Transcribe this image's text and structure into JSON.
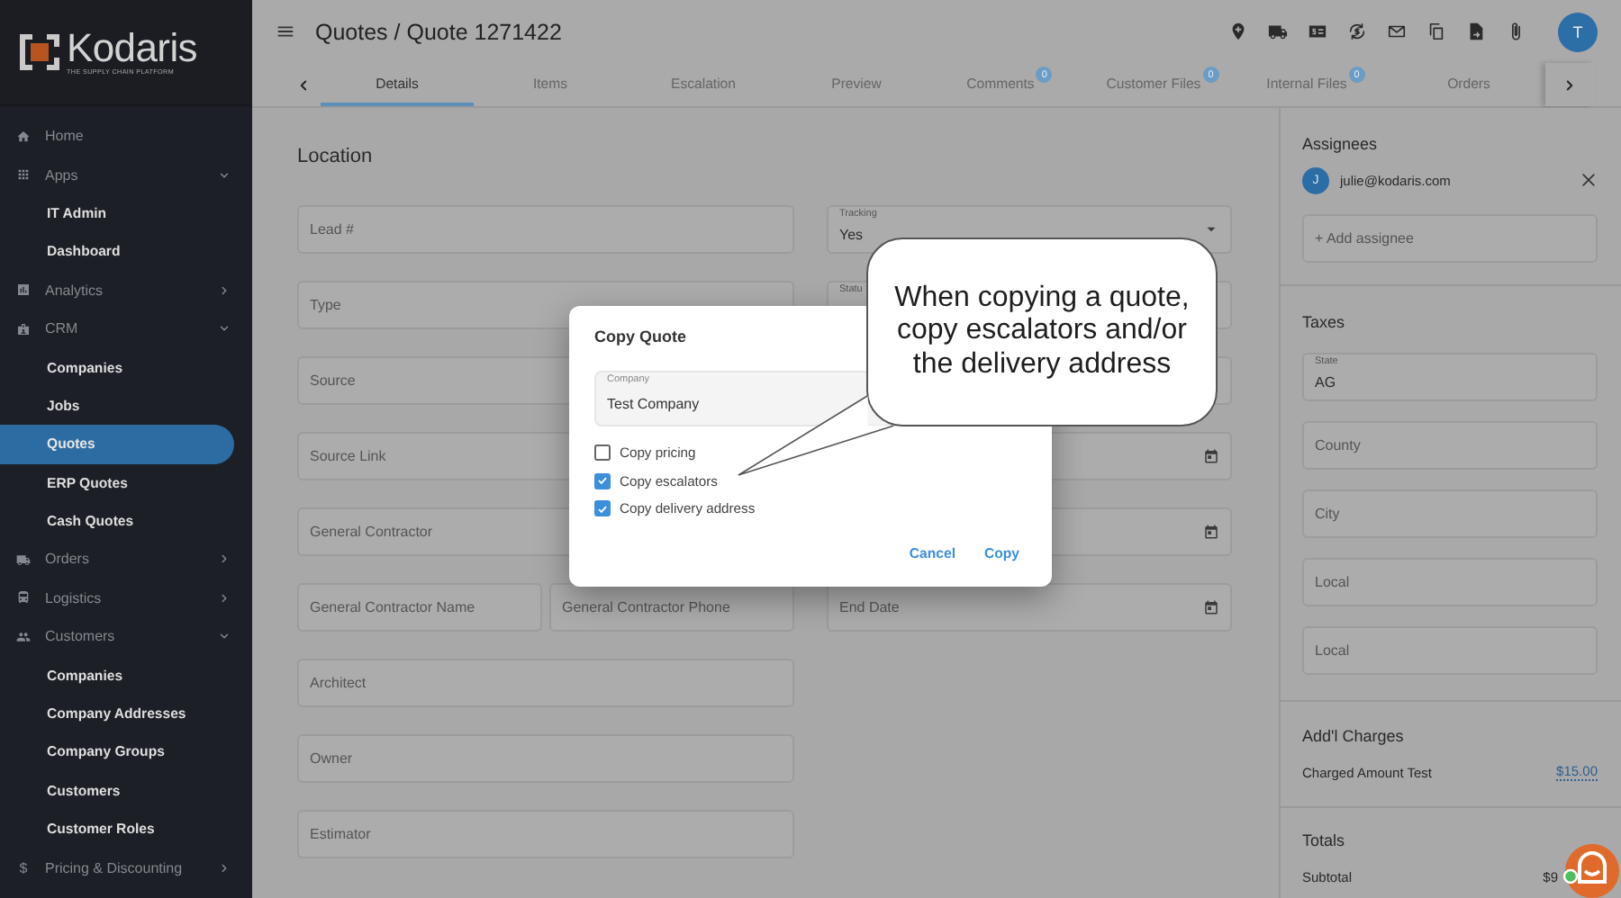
{
  "sidebar": {
    "logo": {
      "name": "Kodaris",
      "tagline": "THE SUPPLY CHAIN PLATFORM"
    },
    "items": [
      {
        "label": "Home"
      },
      {
        "label": "Apps",
        "expanded": true,
        "children": [
          {
            "label": "IT Admin",
            "selected": false
          },
          {
            "label": "Dashboard",
            "selected": false
          }
        ]
      },
      {
        "label": "Analytics",
        "expanded": false
      },
      {
        "label": "CRM",
        "expanded": true,
        "children": [
          {
            "label": "Companies",
            "selected": false
          },
          {
            "label": "Jobs",
            "selected": false
          },
          {
            "label": "Quotes",
            "selected": true
          },
          {
            "label": "ERP Quotes",
            "selected": false
          },
          {
            "label": "Cash Quotes",
            "selected": false
          }
        ]
      },
      {
        "label": "Orders",
        "expanded": false
      },
      {
        "label": "Logistics",
        "expanded": false
      },
      {
        "label": "Customers",
        "expanded": true,
        "children": [
          {
            "label": "Companies",
            "selected": false
          },
          {
            "label": "Company Addresses",
            "selected": false
          },
          {
            "label": "Company Groups",
            "selected": false
          },
          {
            "label": "Customers",
            "selected": false
          },
          {
            "label": "Customer Roles",
            "selected": false
          }
        ]
      },
      {
        "label": "Pricing & Discounting",
        "expanded": false,
        "glyph": "$"
      }
    ]
  },
  "header": {
    "title": "Quotes / Quote 1271422",
    "avatar": "T"
  },
  "tabs": [
    {
      "label": "Details",
      "selected": true
    },
    {
      "label": "Items",
      "selected": false
    },
    {
      "label": "Escalation",
      "selected": false
    },
    {
      "label": "Preview",
      "selected": false
    },
    {
      "label": "Comments",
      "selected": false,
      "badge": "0"
    },
    {
      "label": "Customer Files",
      "selected": false,
      "badge": "0"
    },
    {
      "label": "Internal Files",
      "selected": false,
      "badge": "0"
    },
    {
      "label": "Orders",
      "selected": false
    }
  ],
  "form": {
    "heading": "Location",
    "rows": [
      {
        "left": [
          {
            "placeholder": "Lead #"
          }
        ],
        "right": {
          "kind": "select",
          "label": "Tracking",
          "value": "Yes"
        }
      },
      {
        "left": [
          {
            "placeholder": "Type"
          }
        ],
        "right": {
          "label": "Statu"
        }
      },
      {
        "left": [
          {
            "placeholder": "Source"
          }
        ],
        "right": {}
      },
      {
        "left": [
          {
            "placeholder": "Source Link"
          }
        ],
        "right": {
          "kind": "date"
        }
      },
      {
        "left": [
          {
            "placeholder": "General Contractor"
          }
        ],
        "right": {
          "kind": "date"
        }
      },
      {
        "left": [
          {
            "placeholder": "General Contractor Name"
          },
          {
            "placeholder": "General Contractor Phone"
          }
        ],
        "right": {
          "kind": "date",
          "placeholder": "End Date"
        }
      },
      {
        "left": [
          {
            "placeholder": "Architect"
          }
        ]
      },
      {
        "left": [
          {
            "placeholder": "Owner"
          }
        ]
      },
      {
        "left": [
          {
            "placeholder": "Estimator"
          }
        ]
      }
    ]
  },
  "panel": {
    "assignees": {
      "heading": "Assignees",
      "people": [
        {
          "initial": "J",
          "email": "julie@kodaris.com"
        }
      ],
      "add": {
        "placeholder": "+ Add assignee"
      }
    },
    "taxes": {
      "heading": "Taxes",
      "fields": [
        {
          "label": "State",
          "value": "AG"
        },
        {
          "placeholder": "County"
        },
        {
          "placeholder": "City"
        },
        {
          "placeholder": "Local"
        },
        {
          "placeholder": "Local"
        }
      ]
    },
    "charges": {
      "heading": "Add'l Charges",
      "rows": [
        {
          "label": "Charged Amount Test",
          "value": "$15.00"
        }
      ]
    },
    "totals": {
      "heading": "Totals",
      "rows": [
        {
          "label": "Subtotal",
          "value": "$9"
        }
      ]
    }
  },
  "modal": {
    "title": "Copy Quote",
    "field": {
      "label": "Company",
      "value": "Test Company"
    },
    "options": [
      {
        "label": "Copy pricing",
        "checked": false
      },
      {
        "label": "Copy escalators",
        "checked": true
      },
      {
        "label": "Copy delivery address",
        "checked": true
      }
    ],
    "buttons": [
      "Cancel",
      "Copy"
    ]
  },
  "callout": {
    "text": "When copying a quote, copy escalators and/or the delivery address"
  }
}
